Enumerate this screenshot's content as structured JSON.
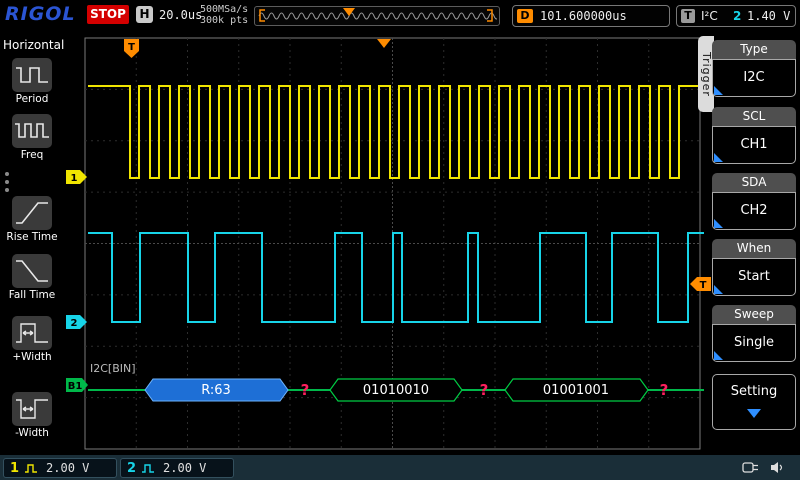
{
  "top_bar": {
    "logo": "RIGOL",
    "run_state": "STOP",
    "h_label": "H",
    "h_value": "20.0us",
    "sample_rate": "500MSa/s",
    "mem_depth": "300k pts",
    "d_label": "D",
    "d_value": "101.600000us",
    "t_label": "T",
    "t_type": "I²C",
    "t_source": "2",
    "t_level": "1.40 V"
  },
  "left_sidebar": {
    "title": "Horizontal",
    "items": [
      "Period",
      "Freq",
      "Rise Time",
      "Fall Time",
      "+Width",
      "-Width"
    ]
  },
  "scope": {
    "ch1_tag": "1",
    "ch2_tag": "2",
    "bus_tag": "B1",
    "decode_label": "I2C[BIN]",
    "trigger_flag": "T",
    "trigger_level_tag": "T",
    "decode_items": [
      "R:63",
      "?",
      "01010010",
      "?",
      "01001001",
      "?"
    ]
  },
  "right_menu": {
    "tab": "Trigger",
    "items": [
      {
        "label": "Type",
        "value": "I2C"
      },
      {
        "label": "SCL",
        "value": "CH1"
      },
      {
        "label": "SDA",
        "value": "CH2"
      },
      {
        "label": "When",
        "value": "Start"
      },
      {
        "label": "Sweep",
        "value": "Single"
      }
    ],
    "setting_label": "Setting"
  },
  "bottom_bar": {
    "ch1_label": "1",
    "ch1_value": "2.00 V",
    "ch2_label": "2",
    "ch2_value": "2.00 V"
  },
  "colors": {
    "ch1": "#f0e500",
    "ch2": "#17d4e8",
    "bus_green": "#00b84a",
    "trigger_orange": "#ff8c00",
    "decode_blue": "#1e6fd6",
    "error_red": "#ff1f5e",
    "accent_blue": "#2f8fff",
    "stop_red": "#d40000"
  }
}
